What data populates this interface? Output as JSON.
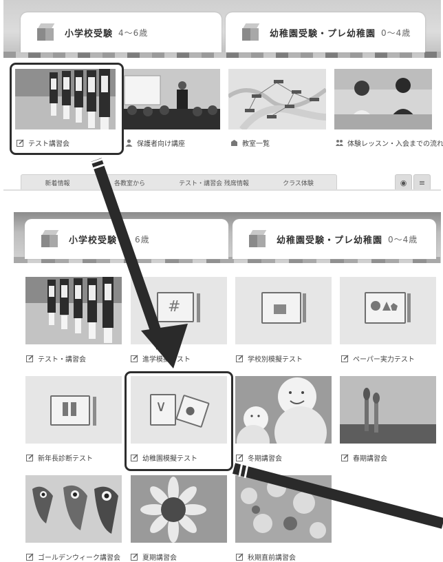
{
  "top_panel": {
    "tab_elementary": {
      "title": "小学校受験",
      "age": "4〜6歳"
    },
    "tab_preschool": {
      "title": "幼稚園受験・プレ幼稚園",
      "age": "0〜4歳"
    },
    "cards": [
      {
        "label": "テスト講習会"
      },
      {
        "label": "保護者向け講座"
      },
      {
        "label": "教室一覧"
      },
      {
        "label": "体験レッスン・入会までの流れ"
      }
    ],
    "nav": [
      "新着情報",
      "各教室から",
      "テスト・講習会 残席情報",
      "クラス体験"
    ],
    "rss_icon": "rss-icon",
    "menu_icon": "menu-icon"
  },
  "bottom_panel": {
    "tab_elementary": {
      "title": "小学校受験",
      "age": "6歳"
    },
    "tab_preschool": {
      "title": "幼稚園受験・プレ幼稚園",
      "age": "0〜4歳"
    },
    "tiles": [
      {
        "label": "テスト・講習会"
      },
      {
        "label": "進学模擬テスト"
      },
      {
        "label": "学校別模擬テスト"
      },
      {
        "label": "ペーパー実力テスト"
      },
      {
        "label": "新年長診断テスト"
      },
      {
        "label": "幼稚園模擬テスト"
      },
      {
        "label": "冬期講習会"
      },
      {
        "label": "春期講習会"
      },
      {
        "label": "ゴールデンウィーク講習会"
      },
      {
        "label": "夏期講習会"
      },
      {
        "label": "秋期直前講習会"
      }
    ]
  }
}
